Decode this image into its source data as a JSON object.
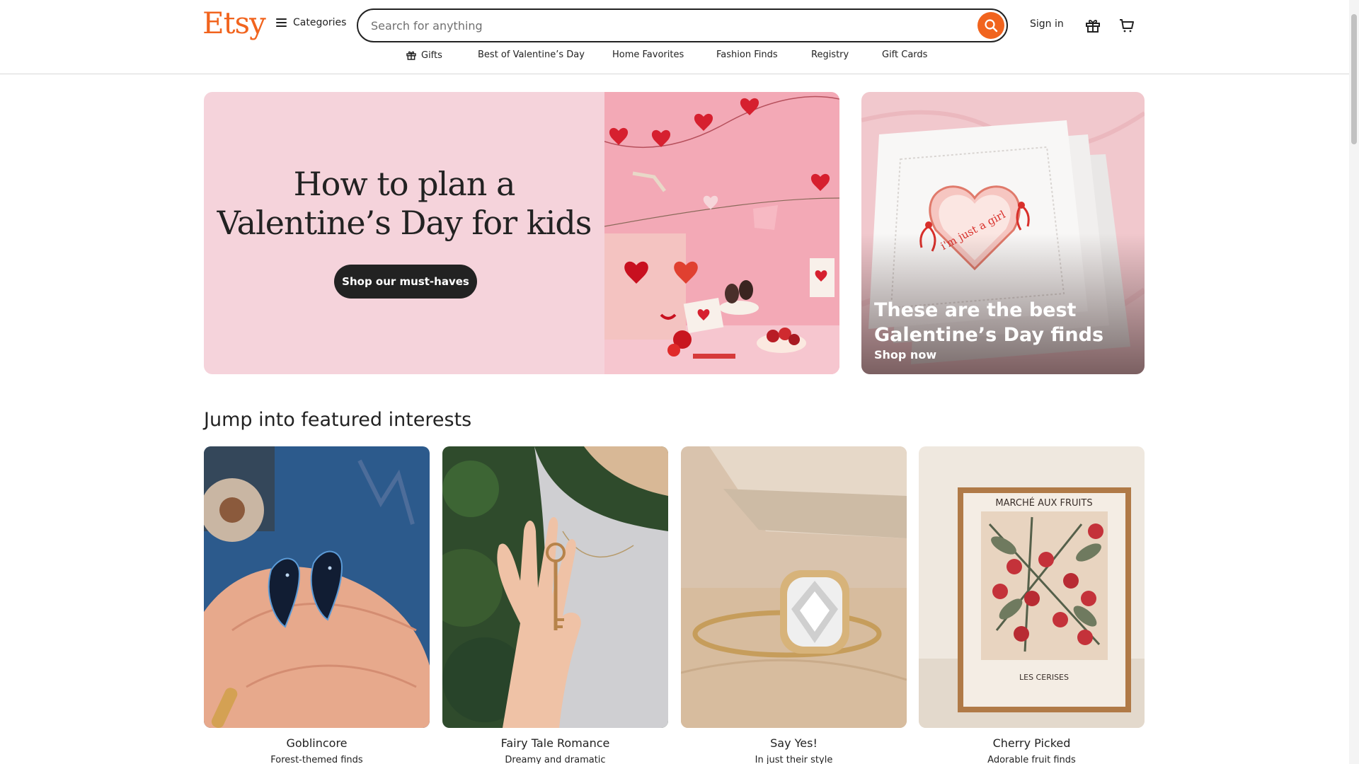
{
  "header": {
    "logo": "Etsy",
    "categories_label": "Categories",
    "search_placeholder": "Search for anything",
    "signin_label": "Sign in",
    "icons": {
      "menu": "hamburger-icon",
      "search": "search-icon",
      "gift": "gift-icon",
      "cart": "cart-icon"
    },
    "accent_color": "#f1641e"
  },
  "subnav": [
    {
      "label": "Gifts",
      "icon": "gift-icon"
    },
    {
      "label": "Best of Valentine’s Day"
    },
    {
      "label": "Home Favorites"
    },
    {
      "label": "Fashion Finds"
    },
    {
      "label": "Registry"
    },
    {
      "label": "Gift Cards"
    }
  ],
  "hero": {
    "title_line1": "How to plan a",
    "title_line2": "Valentine’s Day for kids",
    "button_label": "Shop our must-haves",
    "background": "#f5d3db"
  },
  "promo": {
    "title_line1": "These are the best",
    "title_line2": "Galentine’s Day finds",
    "link_label": "Shop now"
  },
  "interests": {
    "heading": "Jump into featured interests",
    "cards": [
      {
        "title": "Goblincore",
        "subtitle": "Forest-themed finds"
      },
      {
        "title": "Fairy Tale Romance",
        "subtitle": "Dreamy and dramatic"
      },
      {
        "title": "Say Yes!",
        "subtitle": "In just their style"
      },
      {
        "title": "Cherry Picked",
        "subtitle": "Adorable fruit finds"
      }
    ]
  },
  "artwork_text": {
    "poster_title": "MARCHÉ AUX FRUITS",
    "poster_subtitle": "LES CERISES",
    "napkin_text": "i'm just a girl"
  }
}
